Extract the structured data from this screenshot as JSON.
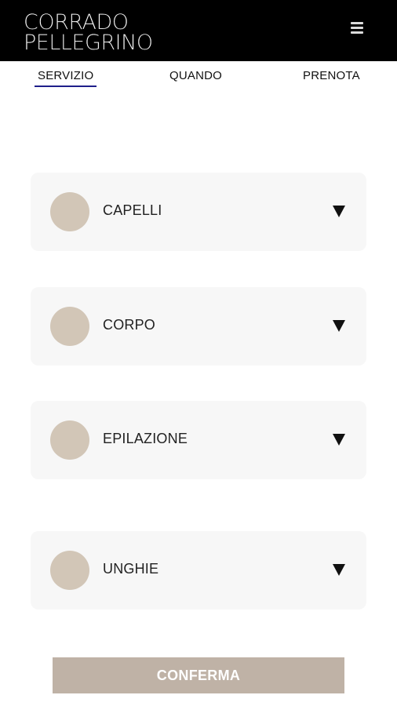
{
  "header": {
    "logo_line1": "CORRADO",
    "logo_line2": "PELLEGRINO",
    "menu_icon": "hamburger-menu-icon"
  },
  "tabs": [
    {
      "label": "SERVIZIO",
      "active": true
    },
    {
      "label": "QUANDO",
      "active": false
    },
    {
      "label": "PRENOTA",
      "active": false
    }
  ],
  "services": [
    {
      "label": "CAPELLI",
      "icon": "chevron-down-icon"
    },
    {
      "label": "CORPO",
      "icon": "chevron-down-icon"
    },
    {
      "label": "EPILAZIONE",
      "icon": "chevron-down-icon"
    },
    {
      "label": "UNGHIE",
      "icon": "chevron-down-icon"
    }
  ],
  "confirm_label": "CONFERMA",
  "colors": {
    "header_bg": "#000000",
    "accent_underline": "#1f1f8a",
    "card_bg": "#f7f7f7",
    "dot": "#d2c6b7",
    "button_bg": "#bfb2a6"
  }
}
